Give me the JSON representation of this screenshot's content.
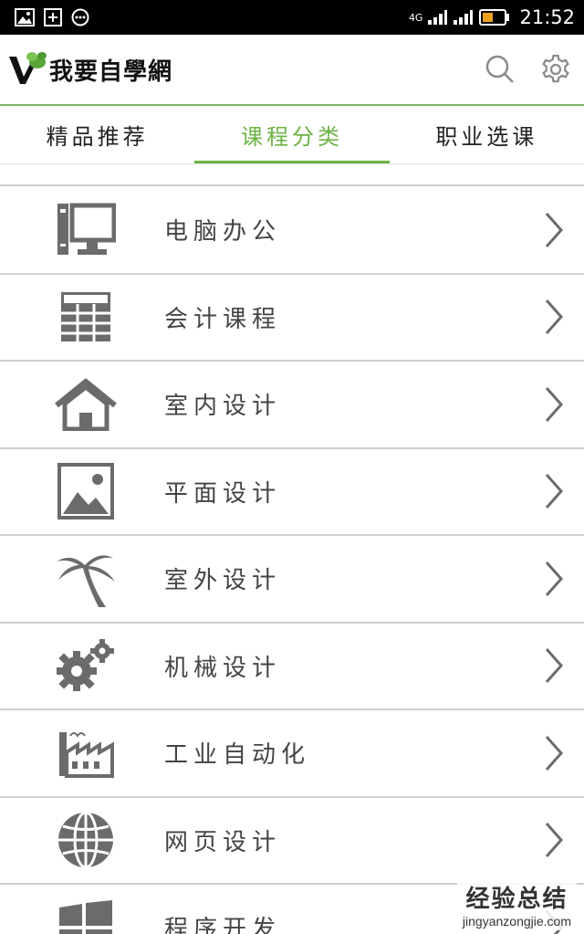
{
  "status_bar": {
    "network": "4G",
    "time": "21:52"
  },
  "header": {
    "app_name": "我要自學網"
  },
  "tabs": [
    {
      "label": "精品推荐",
      "active": false
    },
    {
      "label": "课程分类",
      "active": true
    },
    {
      "label": "职业选课",
      "active": false
    }
  ],
  "categories": [
    {
      "label": "电脑办公",
      "icon": "computer-icon"
    },
    {
      "label": "会计课程",
      "icon": "spreadsheet-icon"
    },
    {
      "label": "室内设计",
      "icon": "house-icon"
    },
    {
      "label": "平面设计",
      "icon": "picture-icon"
    },
    {
      "label": "室外设计",
      "icon": "palm-tree-icon"
    },
    {
      "label": "机械设计",
      "icon": "gears-icon"
    },
    {
      "label": "工业自动化",
      "icon": "factory-icon"
    },
    {
      "label": "网页设计",
      "icon": "globe-icon"
    },
    {
      "label": "程序开发",
      "icon": "windows-icon"
    }
  ],
  "watermark": {
    "brand": "经验总结",
    "url": "jingyanzongjie.com"
  },
  "colors": {
    "accent": "#6cb344",
    "icon_gray": "#6b6b6b",
    "divider": "#cfcfcf"
  }
}
